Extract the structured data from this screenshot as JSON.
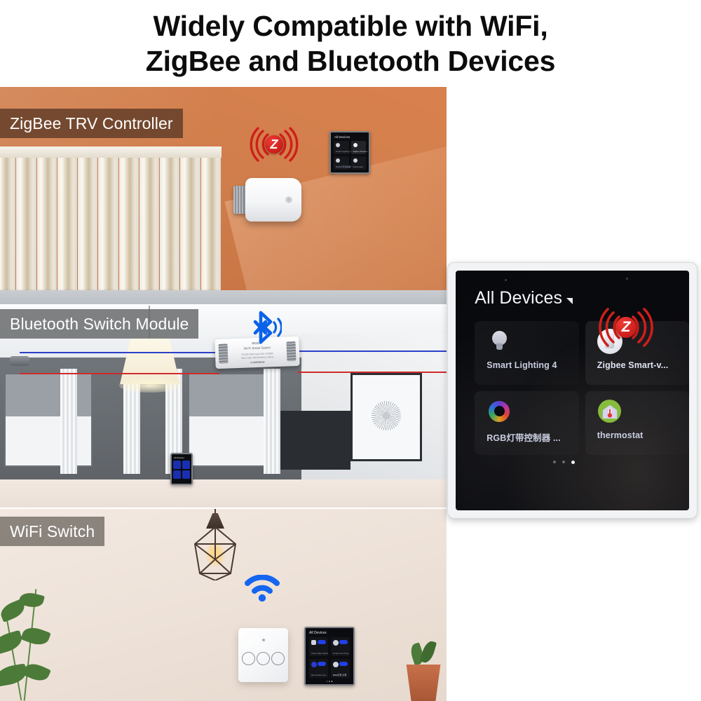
{
  "headline": {
    "line1": "Widely Compatible with WiFi,",
    "line2": "ZigBee and Bluetooth Devices"
  },
  "scenes": [
    {
      "id": "zigbee-trv",
      "tag": "ZigBee TRV Controller",
      "tag_style": "brown",
      "signal": "zigbee"
    },
    {
      "id": "bluetooth-switch",
      "tag": "Bluetooth Switch Module",
      "tag_style": "gray",
      "signal": "bluetooth"
    },
    {
      "id": "wifi-switch",
      "tag": "WiFi Switch",
      "tag_style": "warmgray",
      "signal": "wifi"
    }
  ],
  "bt_module": {
    "brand": "MOES",
    "model": "Wi-Fi Smart Switch",
    "spec_line1": "AC100-240V  Input 10A / 2200W",
    "spec_line2": "Max Load: 10A  Wireless 2.4GHz",
    "warning": "A WARNING"
  },
  "app_panel": {
    "title": "All Devices",
    "caret_icon": "chevron-down-icon",
    "devices": [
      {
        "name": "Smart Lighting 4",
        "icon": "bulb-icon",
        "highlighted": false
      },
      {
        "name": "Zigbee Smart-v...",
        "icon": "zigbee-valve-icon",
        "highlighted": true
      },
      {
        "name": "RGB灯带控制器 ...",
        "icon": "rgb-ring-icon",
        "highlighted": false
      },
      {
        "name": "thermostat",
        "icon": "thermostat-icon",
        "highlighted": false
      }
    ],
    "pager": {
      "count": 3,
      "active_index": 2
    }
  },
  "mini_panel_trv": {
    "title": "All Devices",
    "devices": [
      "Smart Lighting 4",
      "Zigbee Smart-v...",
      "RGB灯带控制器",
      "thermostat"
    ]
  },
  "mini_panel_bt": {
    "title": "All Devices",
    "devices": [
      "Smart Lighting 4",
      "Zigbee Smart-v...",
      "RGB灯带控制器",
      "thermostat"
    ]
  },
  "mini_panel_wifi": {
    "title": "All Devices",
    "devices": [
      "Three Way Switch",
      "Smart One Pring",
      "Mini Smart Line...",
      "BGR灯带 灯带"
    ],
    "toggle_label": "ON"
  },
  "colors": {
    "zigbee_red": "#cf1f1a",
    "bluetooth_blue": "#0a62e8",
    "wifi_blue": "#1565f0",
    "thermostat_green": "#86bb3c",
    "tag_brown": "#5c3a26",
    "tag_gray": "#6a6c6e",
    "app_bg": "#0a0b0f",
    "device_label": "#c9cde0"
  }
}
